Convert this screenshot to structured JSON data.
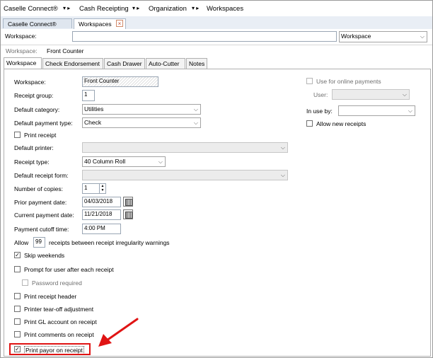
{
  "breadcrumb": {
    "items": [
      "Caselle Connect®",
      "Cash Receipting",
      "Organization",
      "Workspaces"
    ],
    "separator": "▾ ▸"
  },
  "window_tabs": [
    {
      "label": "Caselle Connect®"
    },
    {
      "label": "Workspaces",
      "close": "×"
    }
  ],
  "workspace_bar": {
    "label": "Workspace:",
    "value": "",
    "type_select": "Workspace"
  },
  "crumb_line": {
    "label": "Workspace:",
    "value": "Front Counter"
  },
  "sub_tabs": [
    "Workspace",
    "Check Endorsement",
    "Cash Drawer",
    "Auto-Cutter",
    "Notes"
  ],
  "form": {
    "workspace": {
      "label": "Workspace:",
      "value": "Front Counter"
    },
    "receipt_group": {
      "label": "Receipt group:",
      "value": "1"
    },
    "default_category": {
      "label": "Default category:",
      "value": "Utilities"
    },
    "default_payment_type": {
      "label": "Default payment type:",
      "value": "Check"
    },
    "print_receipt": {
      "label": "Print receipt",
      "checked": false
    },
    "default_printer": {
      "label": "Default printer:",
      "value": ""
    },
    "receipt_type": {
      "label": "Receipt type:",
      "value": "40 Column Roll"
    },
    "default_receipt_form": {
      "label": "Default receipt form:",
      "value": ""
    },
    "number_of_copies": {
      "label": "Number of copies:",
      "value": "1"
    },
    "prior_payment_date": {
      "label": "Prior payment date:",
      "value": "04/03/2018"
    },
    "current_payment_date": {
      "label": "Current payment date:",
      "value": "11/21/2018"
    },
    "payment_cutoff_time": {
      "label": "Payment cutoff time:",
      "value": "4:00 PM"
    },
    "allow_prefix": "Allow",
    "allow_value": "99",
    "allow_suffix": "receipts between receipt irregularity warnings",
    "checkboxes": [
      {
        "label": "Skip weekends",
        "checked": true
      },
      {
        "label": "Prompt for user after each receipt",
        "checked": false
      },
      {
        "label": "Password required",
        "checked": false,
        "disabled": true
      },
      {
        "label": "Print receipt header",
        "checked": false
      },
      {
        "label": "Printer tear-off adjustment",
        "checked": false
      },
      {
        "label": "Print GL account on receipt",
        "checked": false
      },
      {
        "label": "Print comments on receipt",
        "checked": false
      },
      {
        "label": "Print payor on receipt",
        "checked": true
      }
    ]
  },
  "right": {
    "online_payments": {
      "label": "Use for online payments",
      "checked": false,
      "disabled": true
    },
    "user": {
      "label": "User:",
      "value": ""
    },
    "in_use_by": {
      "label": "In use by:",
      "value": ""
    },
    "allow_new_receipts": {
      "label": "Allow new receipts",
      "checked": false
    }
  },
  "annotation": {
    "arrow_color": "#e01414",
    "highlight_color": "#e01414"
  }
}
